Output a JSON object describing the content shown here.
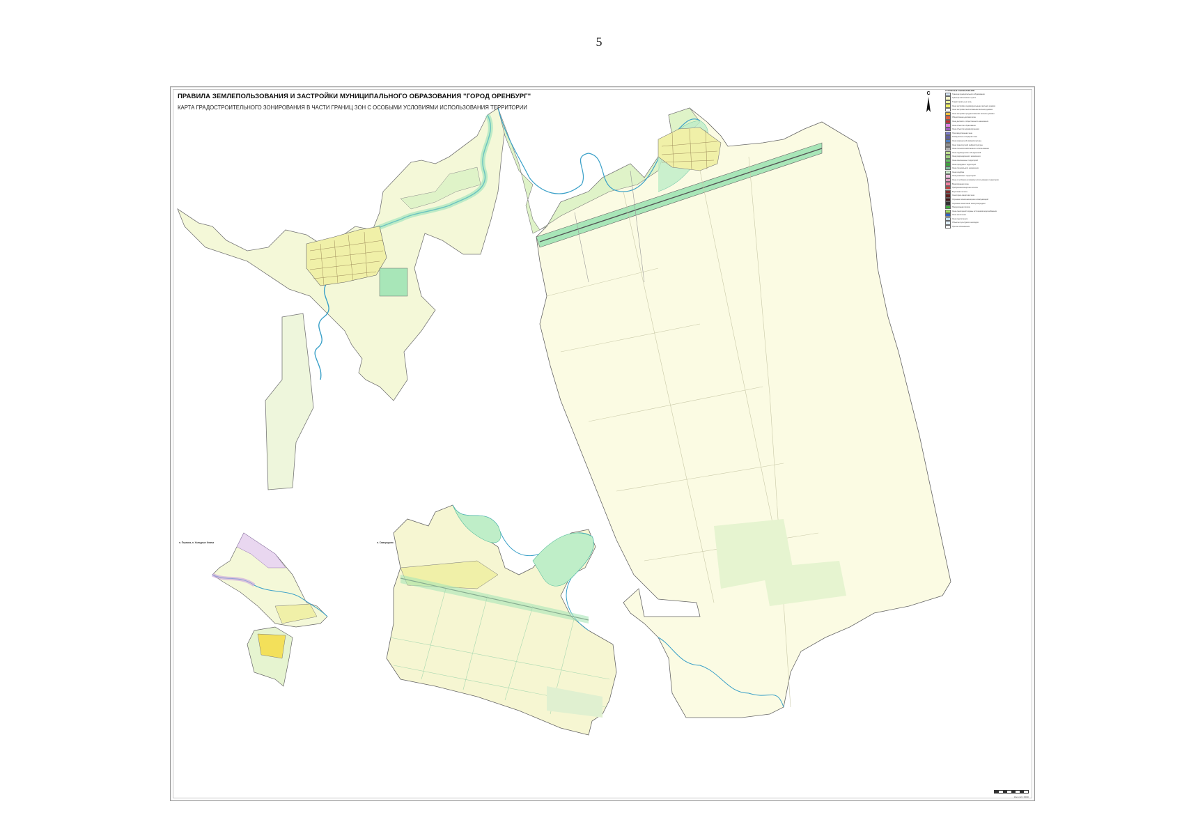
{
  "page": {
    "number": "5"
  },
  "map": {
    "title": "ПРАВИЛА ЗЕМЛЕПОЛЬЗОВАНИЯ И ЗАСТРОЙКИ МУНИЦИПАЛЬНОГО ОБРАЗОВАНИЯ \"ГОРОД ОРЕНБУРГ\"",
    "subtitle": "КАРТА ГРАДОСТРОИТЕЛЬНОГО ЗОНИРОВАНИЯ В ЧАСТИ ГРАНИЦ ЗОН С ОСОБЫМИ УСЛОВИЯМИ ИСПОЛЬЗОВАНИЯ ТЕРРИТОРИИ",
    "north_label": "С",
    "inset_labels": [
      "п. Пережок, п. Холодные Ключи",
      "п. Самородово"
    ],
    "colors": {
      "field": "#fbfbe3",
      "field_light": "#f4f8d8",
      "greenery": "#bfeec8",
      "water_zone": "#8fe0b8",
      "river": "#3aa0c8",
      "road": "#8a8a8a",
      "boundary": "#555555",
      "residential": "#f3e05a",
      "special": "#c9a0e0"
    }
  },
  "legend": {
    "title": "УСЛОВНЫЕ ОБОЗНАЧЕНИЯ",
    "items": [
      {
        "color": "#d8e8f8",
        "label": "Граница муниципального образования"
      },
      {
        "color": "#f6f6c8",
        "label": "Граница населенного пункта"
      },
      {
        "color": "#e8f4a0",
        "label": "Территориальные зоны"
      },
      {
        "color": "#f0f060",
        "label": "Зона застройки индивидуальными жилыми домами"
      },
      {
        "color": "#ffffff",
        "label": "Зона застройки малоэтажными жилыми домами"
      },
      {
        "color": "#f4c040",
        "label": "Зона застройки среднеэтажными жилыми домами"
      },
      {
        "color": "#e06040",
        "label": "Общественно-деловая зона"
      },
      {
        "color": "#c03030",
        "label": "Зона делового, общественного назначения"
      },
      {
        "color": "#e080e0",
        "label": "Зона объектов образования"
      },
      {
        "color": "#a060c0",
        "label": "Зона объектов здравоохранения"
      },
      {
        "color": "#8080d0",
        "label": "Производственная зона"
      },
      {
        "color": "#6060a0",
        "label": "Коммунально-складская зона"
      },
      {
        "color": "#5080c0",
        "label": "Зона инженерной инфраструктуры"
      },
      {
        "color": "#909090",
        "label": "Зона транспортной инфраструктуры"
      },
      {
        "color": "#b0b0b0",
        "label": "Зона сельскохозяйственного использования"
      },
      {
        "color": "#c0e090",
        "label": "Зона садоводческих объединений"
      },
      {
        "color": "#a0d080",
        "label": "Зона рекреационного назначения"
      },
      {
        "color": "#60c060",
        "label": "Зона озелененных территорий"
      },
      {
        "color": "#40a040",
        "label": "Зона природных территорий"
      },
      {
        "color": "#80c0a0",
        "label": "Зона специального назначения"
      },
      {
        "color": "#d0f0d0",
        "label": "Зона кладбищ"
      },
      {
        "color": "#f0c0e0",
        "label": "Зона режимных территорий"
      },
      {
        "color": "#e0a0c0",
        "label": "Зоны с особыми условиями использования территории"
      },
      {
        "color": "#f080a0",
        "label": "Водоохранная зона"
      },
      {
        "color": "#c04040",
        "label": "Прибрежная защитная полоса"
      },
      {
        "color": "#803030",
        "label": "Береговая полоса"
      },
      {
        "color": "#602020",
        "label": "Санитарно-защитная зона"
      },
      {
        "color": "#401818",
        "label": "Охранная зона инженерных коммуникаций"
      },
      {
        "color": "#303030",
        "label": "Охранная зона линий электропередачи"
      },
      {
        "color": "#40b040",
        "label": "Придорожная полоса"
      },
      {
        "color": "#a0e060",
        "label": "Зона санитарной охраны источников водоснабжения"
      },
      {
        "color": "#3060c0",
        "label": "Зона затопления"
      },
      {
        "color": "#c0e0f0",
        "label": "Зона подтопления"
      },
      {
        "color": "#e0f0ff",
        "label": "Объекты культурного наследия"
      },
      {
        "color": "#ffffff",
        "label": "Прочие обозначения"
      }
    ]
  },
  "scale": {
    "note": "Масштаб 1:25000"
  }
}
